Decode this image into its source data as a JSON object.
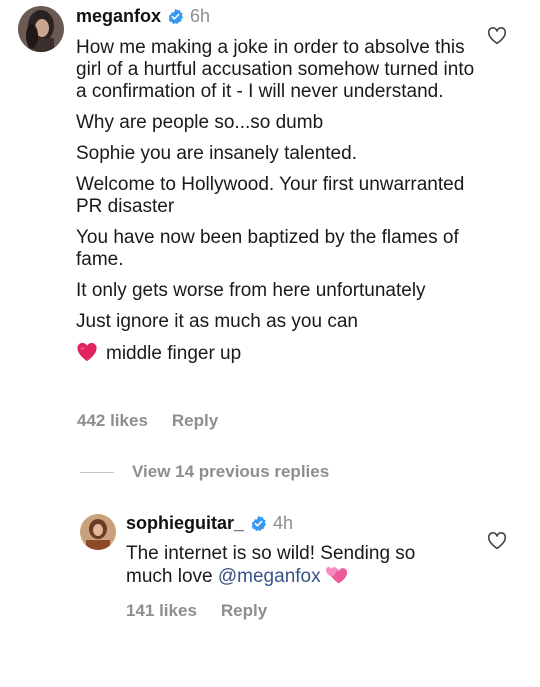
{
  "comment_main": {
    "username": "meganfox",
    "time": "6h",
    "lines": [
      "How me making a joke in order to absolve this girl of a hurtful accusation somehow turned into a confirmation of it - I will never understand.",
      "Why are people so...so dumb",
      "Sophie you are insanely talented.",
      "Welcome to Hollywood. Your first unwarranted PR disaster",
      "You have now been baptized by the flames of fame.",
      "It only gets worse from here unfortunately",
      "Just ignore it as much as you can"
    ],
    "last_line_text": "middle finger up",
    "last_line_emoji": "red-heart-emoji",
    "likes": "442 likes",
    "reply_label": "Reply"
  },
  "view_replies_label": "View 14 previous replies",
  "reply_comment": {
    "username": "sophieguitar_",
    "time": "4h",
    "text_before_mention": "The internet is so wild! Sending so much love ",
    "mention": "@meganfox",
    "trailing_emoji": "two-hearts-emoji",
    "likes": "141 likes",
    "reply_label": "Reply"
  },
  "icons": {
    "verified": "verified-badge-icon",
    "like": "heart-outline-icon"
  },
  "colors": {
    "verified_blue": "#3897f0",
    "secondary_text": "#8e8e8e",
    "mention_link": "#385185",
    "red_heart": "#e0245e"
  }
}
